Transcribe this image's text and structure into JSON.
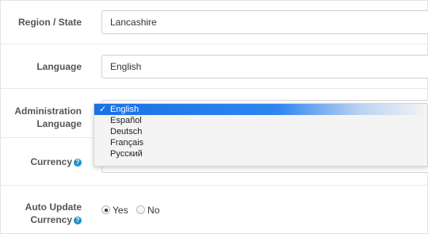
{
  "region": {
    "label": "Region / State",
    "value": "Lancashire"
  },
  "language": {
    "label": "Language",
    "value": "English"
  },
  "admin_language": {
    "label_line1": "Administration",
    "label_line2": "Language",
    "options": [
      "English",
      "Español",
      "Deutsch",
      "Français",
      "Русский"
    ],
    "selected": "English"
  },
  "currency": {
    "label": "Currency",
    "help_icon": "question-circle-icon"
  },
  "auto_update": {
    "label_line1": "Auto Update",
    "label_line2": "Currency",
    "help_icon": "question-circle-icon",
    "yes_label": "Yes",
    "no_label": "No",
    "selected": "Yes"
  },
  "colors": {
    "accent": "#1e91cf",
    "selection": "#2a7ff0"
  }
}
